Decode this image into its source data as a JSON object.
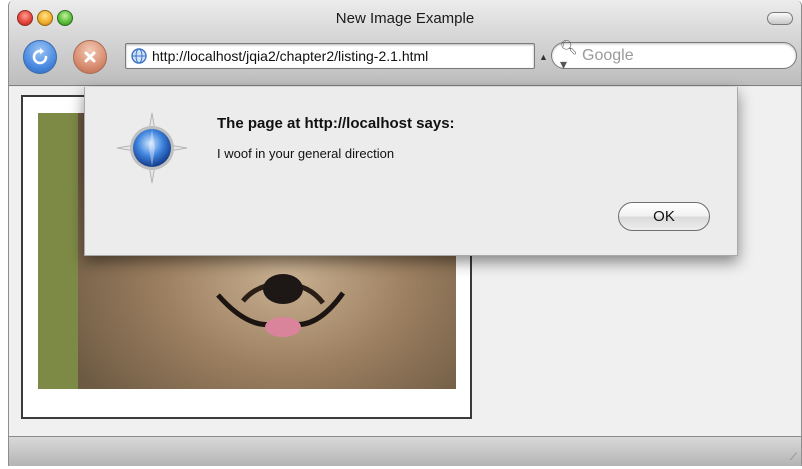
{
  "window": {
    "title": "New Image Example"
  },
  "toolbar": {
    "reload_icon": "reload-icon",
    "stop_icon": "stop-icon",
    "url": "http://localhost/jqia2/chapter2/listing-2.1.html",
    "search_placeholder": "Google"
  },
  "dialog": {
    "heading": "The page at http://localhost says:",
    "message": "I woof in your general direction",
    "ok_label": "OK",
    "icon": "safari-compass-icon"
  },
  "content": {
    "image_alt_icon": "dog-photo"
  },
  "colors": {
    "reload": "#4a8ae0",
    "stop": "#d88d70",
    "dialog_bg": "#ececec"
  }
}
